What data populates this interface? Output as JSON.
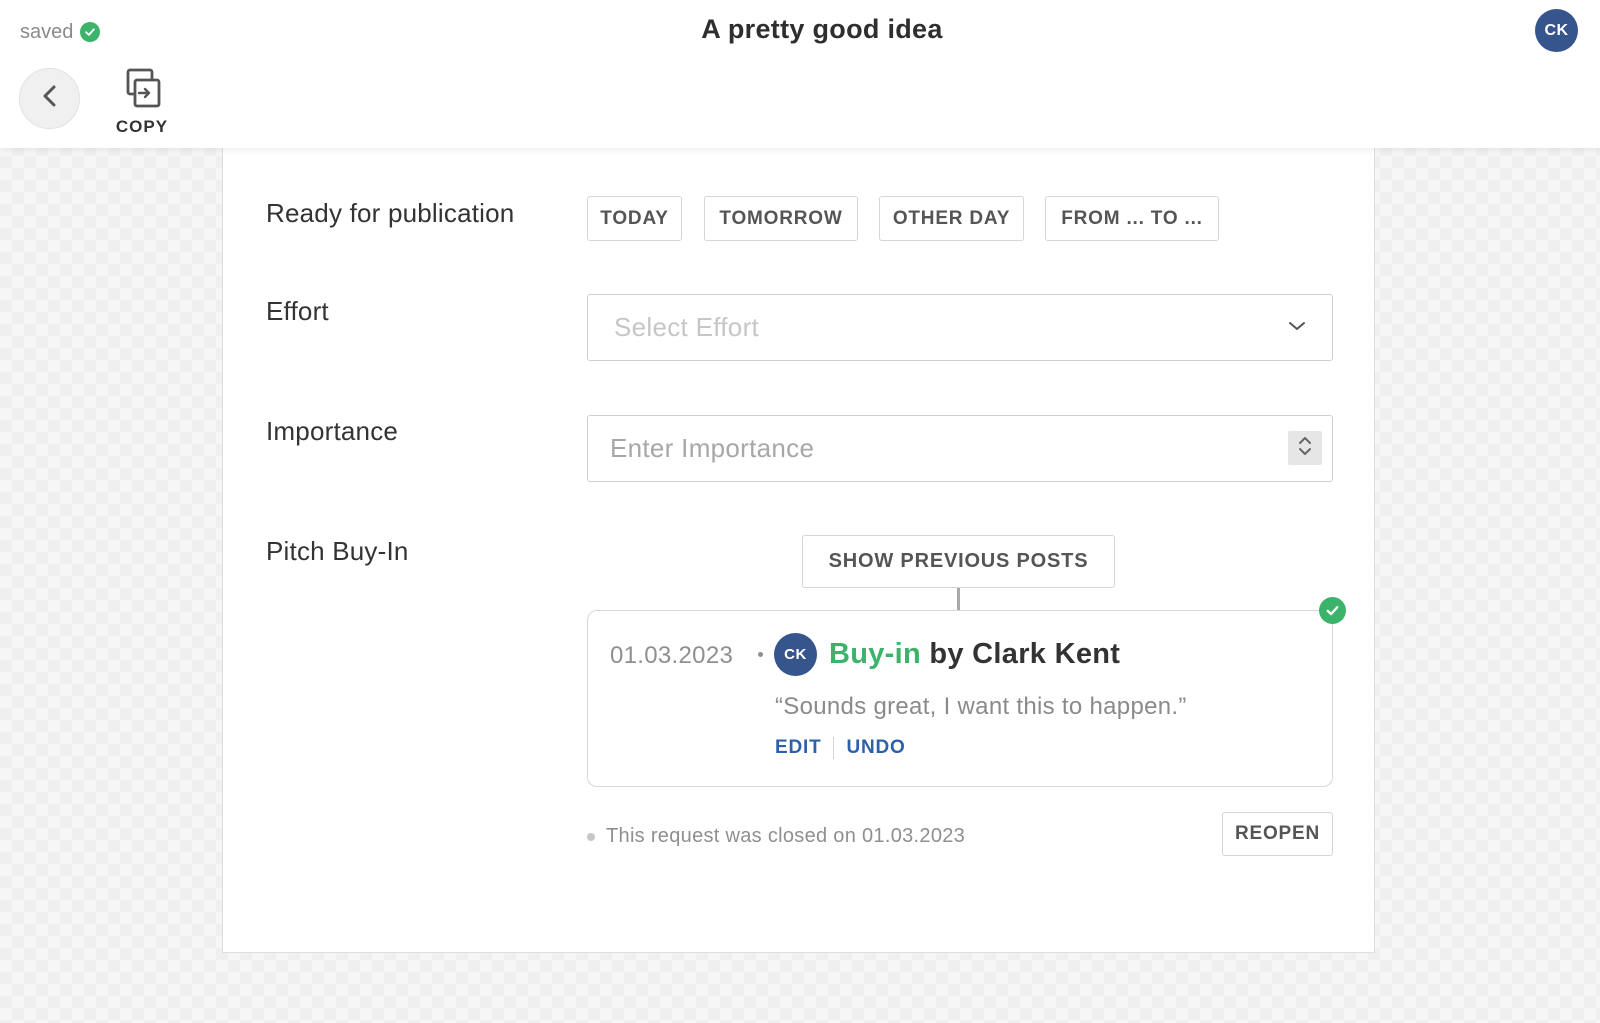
{
  "header": {
    "saved_text": "saved",
    "title": "A pretty good idea",
    "user_initials": "CK",
    "copy_label": "COPY"
  },
  "colors": {
    "success": "#3cb36a",
    "avatar": "#35558c",
    "link": "#2d60a8"
  },
  "icons": {
    "saved": "check-circle-icon",
    "back": "chevron-left-icon",
    "copy": "copy-icon",
    "select": "chevron-down-icon",
    "stepper": "up-down-stepper-icon",
    "post_status": "check-circle-icon"
  },
  "form": {
    "publication": {
      "label": "Ready for publication",
      "options": [
        "TODAY",
        "TOMORROW",
        "OTHER DAY",
        "FROM ... TO ..."
      ]
    },
    "effort": {
      "label": "Effort",
      "placeholder": "Select Effort",
      "value": ""
    },
    "importance": {
      "label": "Importance",
      "placeholder": "Enter Importance",
      "value": ""
    },
    "pitch": {
      "label": "Pitch Buy-In",
      "show_previous_label": "SHOW PREVIOUS POSTS",
      "post": {
        "date": "01.03.2023",
        "author_initials": "CK",
        "kind": "Buy-in",
        "by_author": "by Clark Kent",
        "quote": "“Sounds great, I want this to happen.”",
        "edit_label": "EDIT",
        "undo_label": "UNDO"
      },
      "closed_text": "This request was closed on 01.03.2023",
      "reopen_label": "REOPEN"
    }
  }
}
